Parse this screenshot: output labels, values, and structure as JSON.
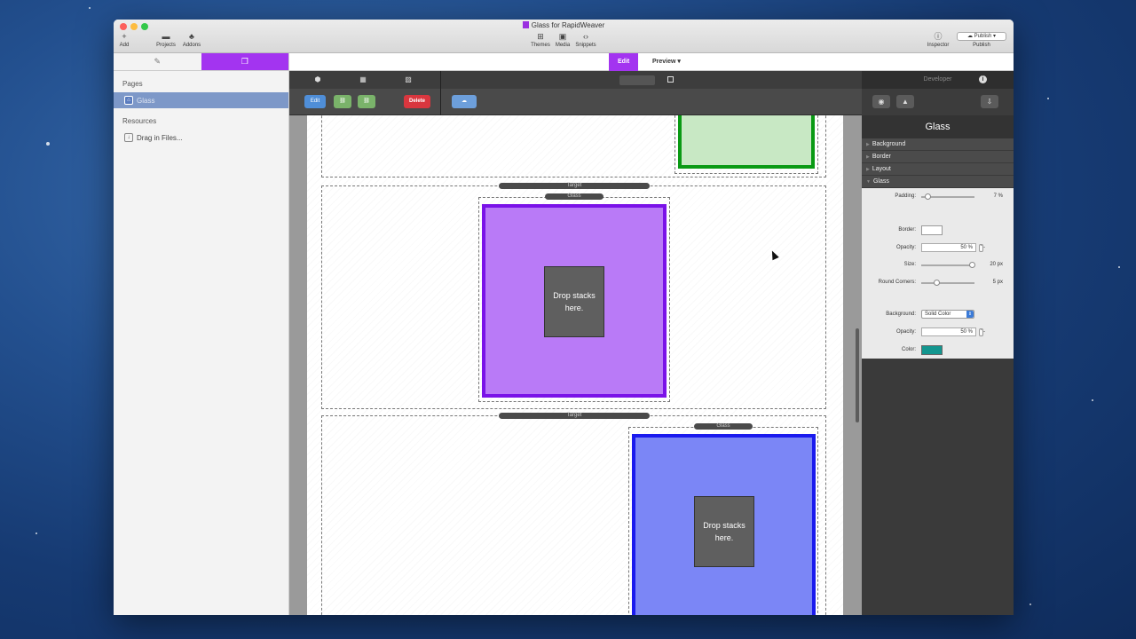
{
  "window": {
    "title": "Glass for RapidWeaver",
    "traffic_colors": [
      "#fc605c",
      "#fdbc40",
      "#34c84a"
    ]
  },
  "toolbar": {
    "add_label": "Add",
    "projects_label": "Projects",
    "addons_label": "Addons",
    "themes_label": "Themes",
    "media_label": "Media",
    "snippets_label": "Snippets",
    "inspector_label": "Inspector",
    "publish_button": "Publish",
    "publish_label": "Publish"
  },
  "sidebar": {
    "pages_header": "Pages",
    "page_item": "Glass",
    "resources_header": "Resources",
    "resources_item": "Drag in Files..."
  },
  "modebar": {
    "edit_label": "Edit",
    "preview_label": "Preview"
  },
  "stacks_bar": {
    "edit_button": "Edit",
    "delete_button": "Delete"
  },
  "canvas": {
    "target_label_1": "Target",
    "glass_label_1": "Glass",
    "drop_text_1": "Drop stacks here.",
    "target_label_2": "Target",
    "glass_label_2": "Glass",
    "drop_text_2": "Drop stacks here.",
    "colors": {
      "green_fill": "#c8e8c4",
      "green_border": "#0a9a14",
      "purple_fill": "#b97af7",
      "purple_border": "#7a12e8",
      "blue_fill": "#7b86f6",
      "blue_border": "#1a1aee"
    }
  },
  "inspector": {
    "top_label": "Developer",
    "title": "Glass",
    "sections": [
      "Background",
      "Border",
      "Layout",
      "Glass"
    ],
    "padding_label": "Padding:",
    "padding_value": "7 %",
    "border_label": "Border:",
    "opacity_label": "Opacity:",
    "opacity_value": "50 %",
    "size_label": "Size:",
    "size_value": "20 px",
    "round_corners_label": "Round Corners:",
    "round_corners_value": "5 px",
    "background_label": "Background:",
    "background_value": "Solid Color",
    "bg_opacity_label": "Opacity:",
    "bg_opacity_value": "50 %",
    "color_label": "Color:",
    "color_swatch": "#13968f"
  }
}
